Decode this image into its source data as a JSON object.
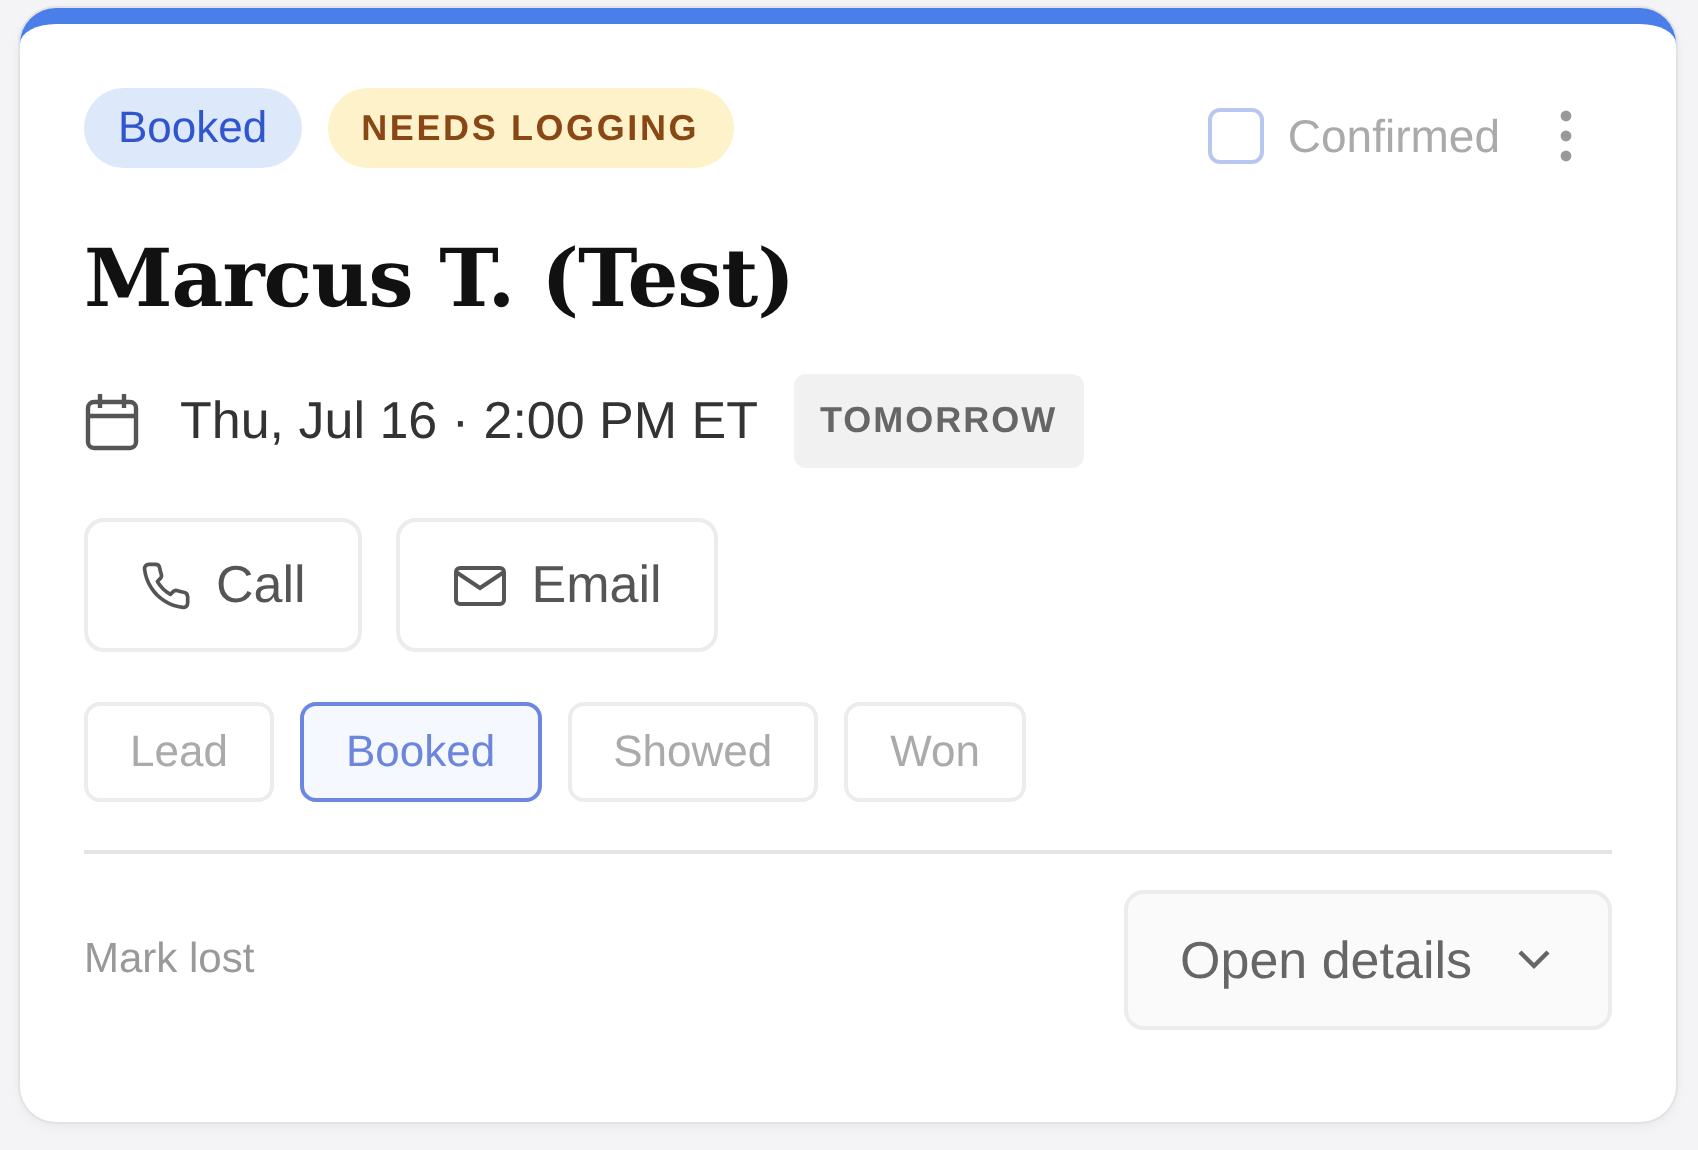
{
  "badges": [
    {
      "label": "Booked",
      "kind": "status"
    },
    {
      "label": "NEEDS LOGGING",
      "kind": "warning"
    }
  ],
  "confirmed": {
    "label": "Confirmed",
    "checked": false
  },
  "title": "Marcus T. (Test)",
  "when": {
    "text": "Thu, Jul 16 · 2:00 PM ET",
    "tag": "TOMORROW"
  },
  "actions": [
    {
      "label": "Call",
      "kind": "phone"
    },
    {
      "label": "Email",
      "kind": "email"
    }
  ],
  "stages": [
    {
      "label": "Lead",
      "selected": false
    },
    {
      "label": "Booked",
      "selected": true
    },
    {
      "label": "Showed",
      "selected": false
    },
    {
      "label": "Won",
      "selected": false
    }
  ],
  "footer": {
    "link": "Mark lost",
    "button": "Open details"
  }
}
